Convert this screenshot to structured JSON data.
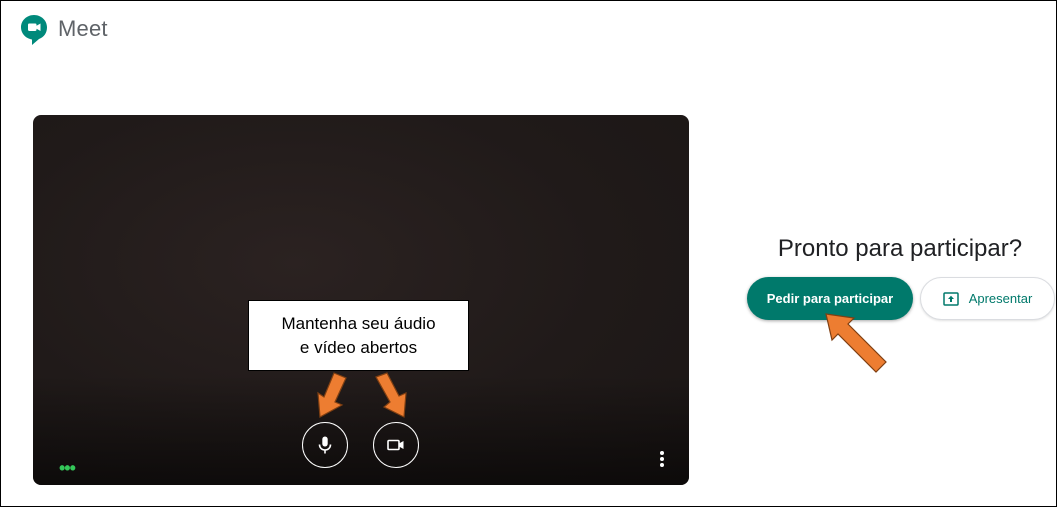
{
  "app": {
    "title": "Meet"
  },
  "preview": {
    "mic_icon": "microphone-icon",
    "camera_icon": "videocam-icon",
    "more_icon": "more-vert-icon",
    "dots_text": "•••"
  },
  "annotation": {
    "line1": "Mantenha seu áudio",
    "line2": "e vídeo abertos"
  },
  "join_panel": {
    "title": "Pronto para participar?",
    "join_button": "Pedir para participar",
    "present_button": "Apresentar",
    "present_icon": "present-to-all-icon"
  },
  "colors": {
    "accent": "#00796b",
    "arrow": "#ed7d31",
    "arrow_outline": "#7f3f12"
  }
}
